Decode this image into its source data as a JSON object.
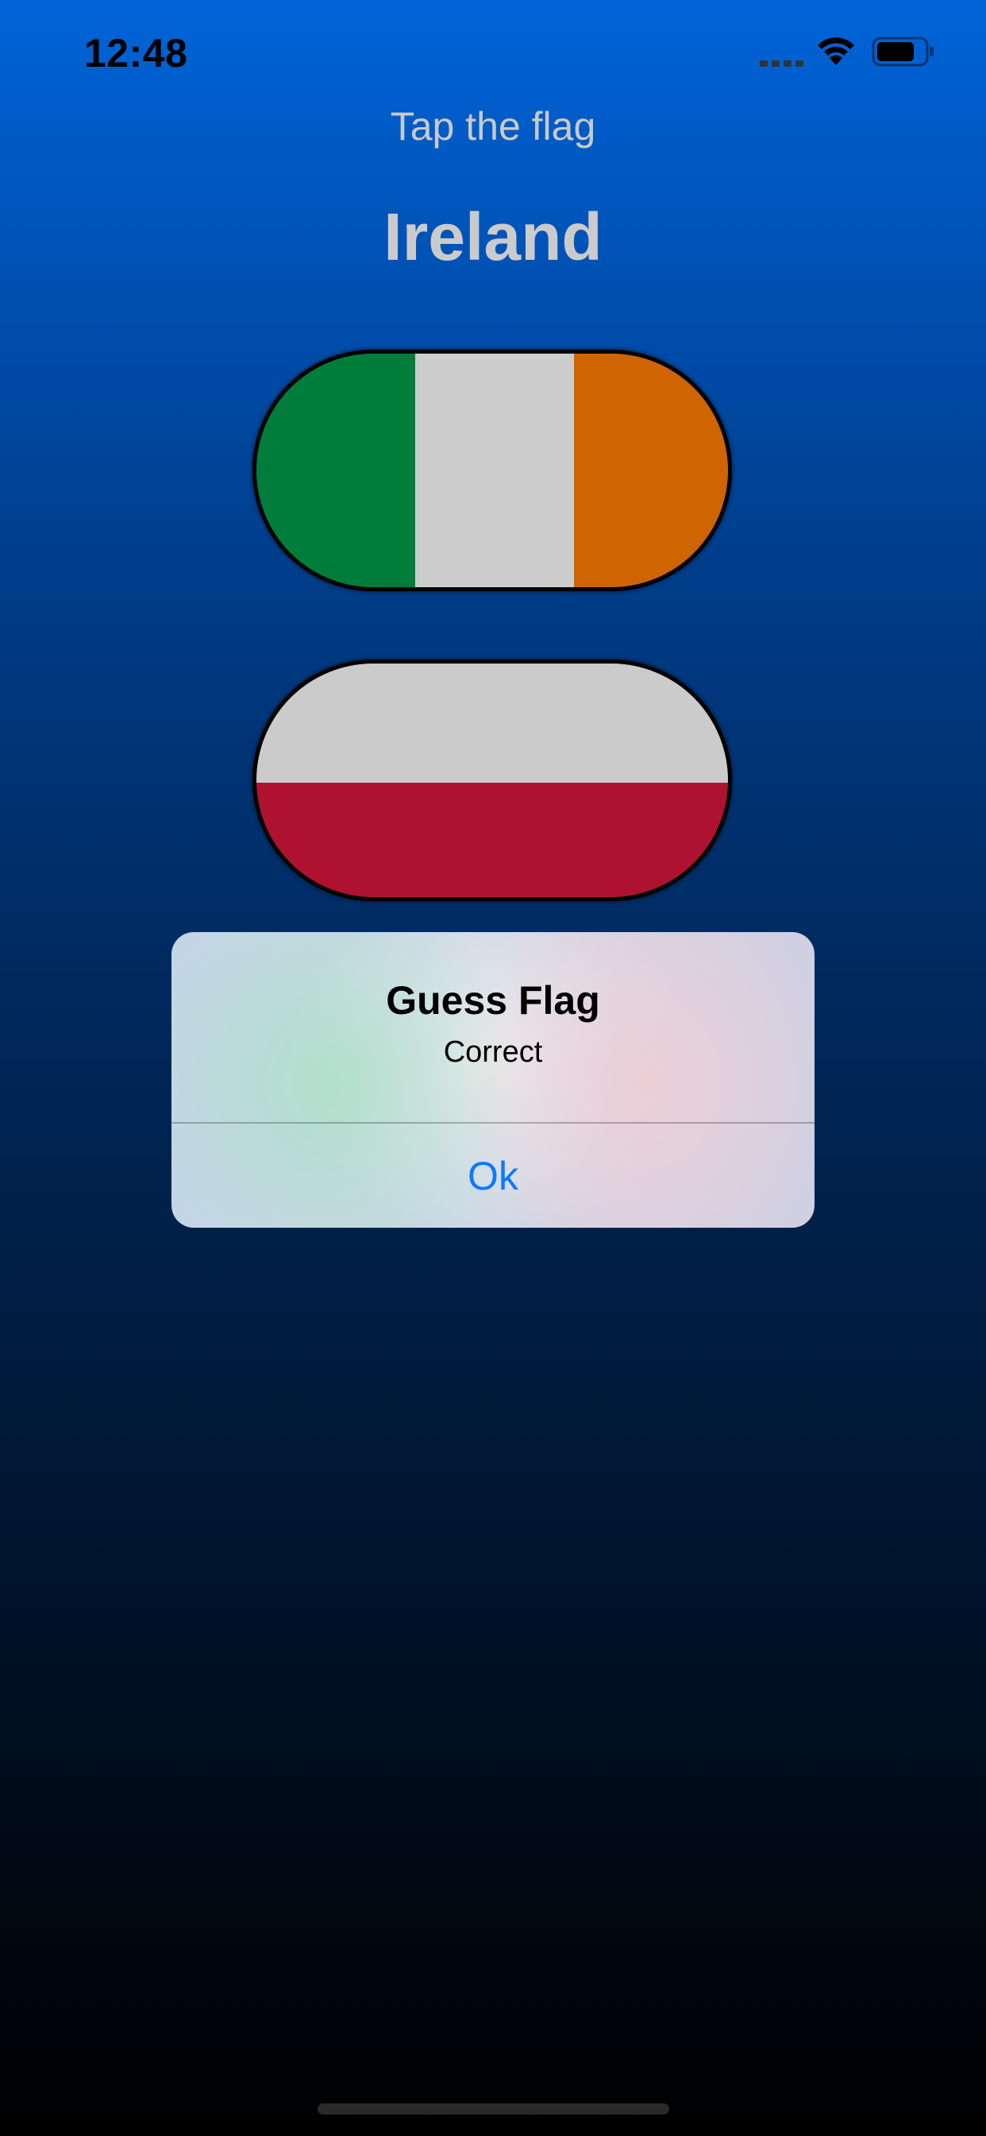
{
  "status_bar": {
    "time": "12:48",
    "icons": [
      "signal-icon",
      "wifi-icon",
      "battery-icon"
    ]
  },
  "game": {
    "instruction": "Tap the flag",
    "country": "Ireland",
    "flags": [
      {
        "name": "Ireland",
        "colors": [
          "#007d3b",
          "#cdcdcd",
          "#cf6400"
        ]
      },
      {
        "name": "Poland",
        "colors": [
          "#cbcbcb",
          "#af1231"
        ]
      }
    ]
  },
  "alert": {
    "title": "Guess Flag",
    "message": "Correct",
    "button_label": "Ok",
    "button_color": "#0a7aff"
  },
  "colors": {
    "background_top": "#0064d8",
    "background_bottom": "#000000",
    "title_text": "#cbcbcb"
  }
}
